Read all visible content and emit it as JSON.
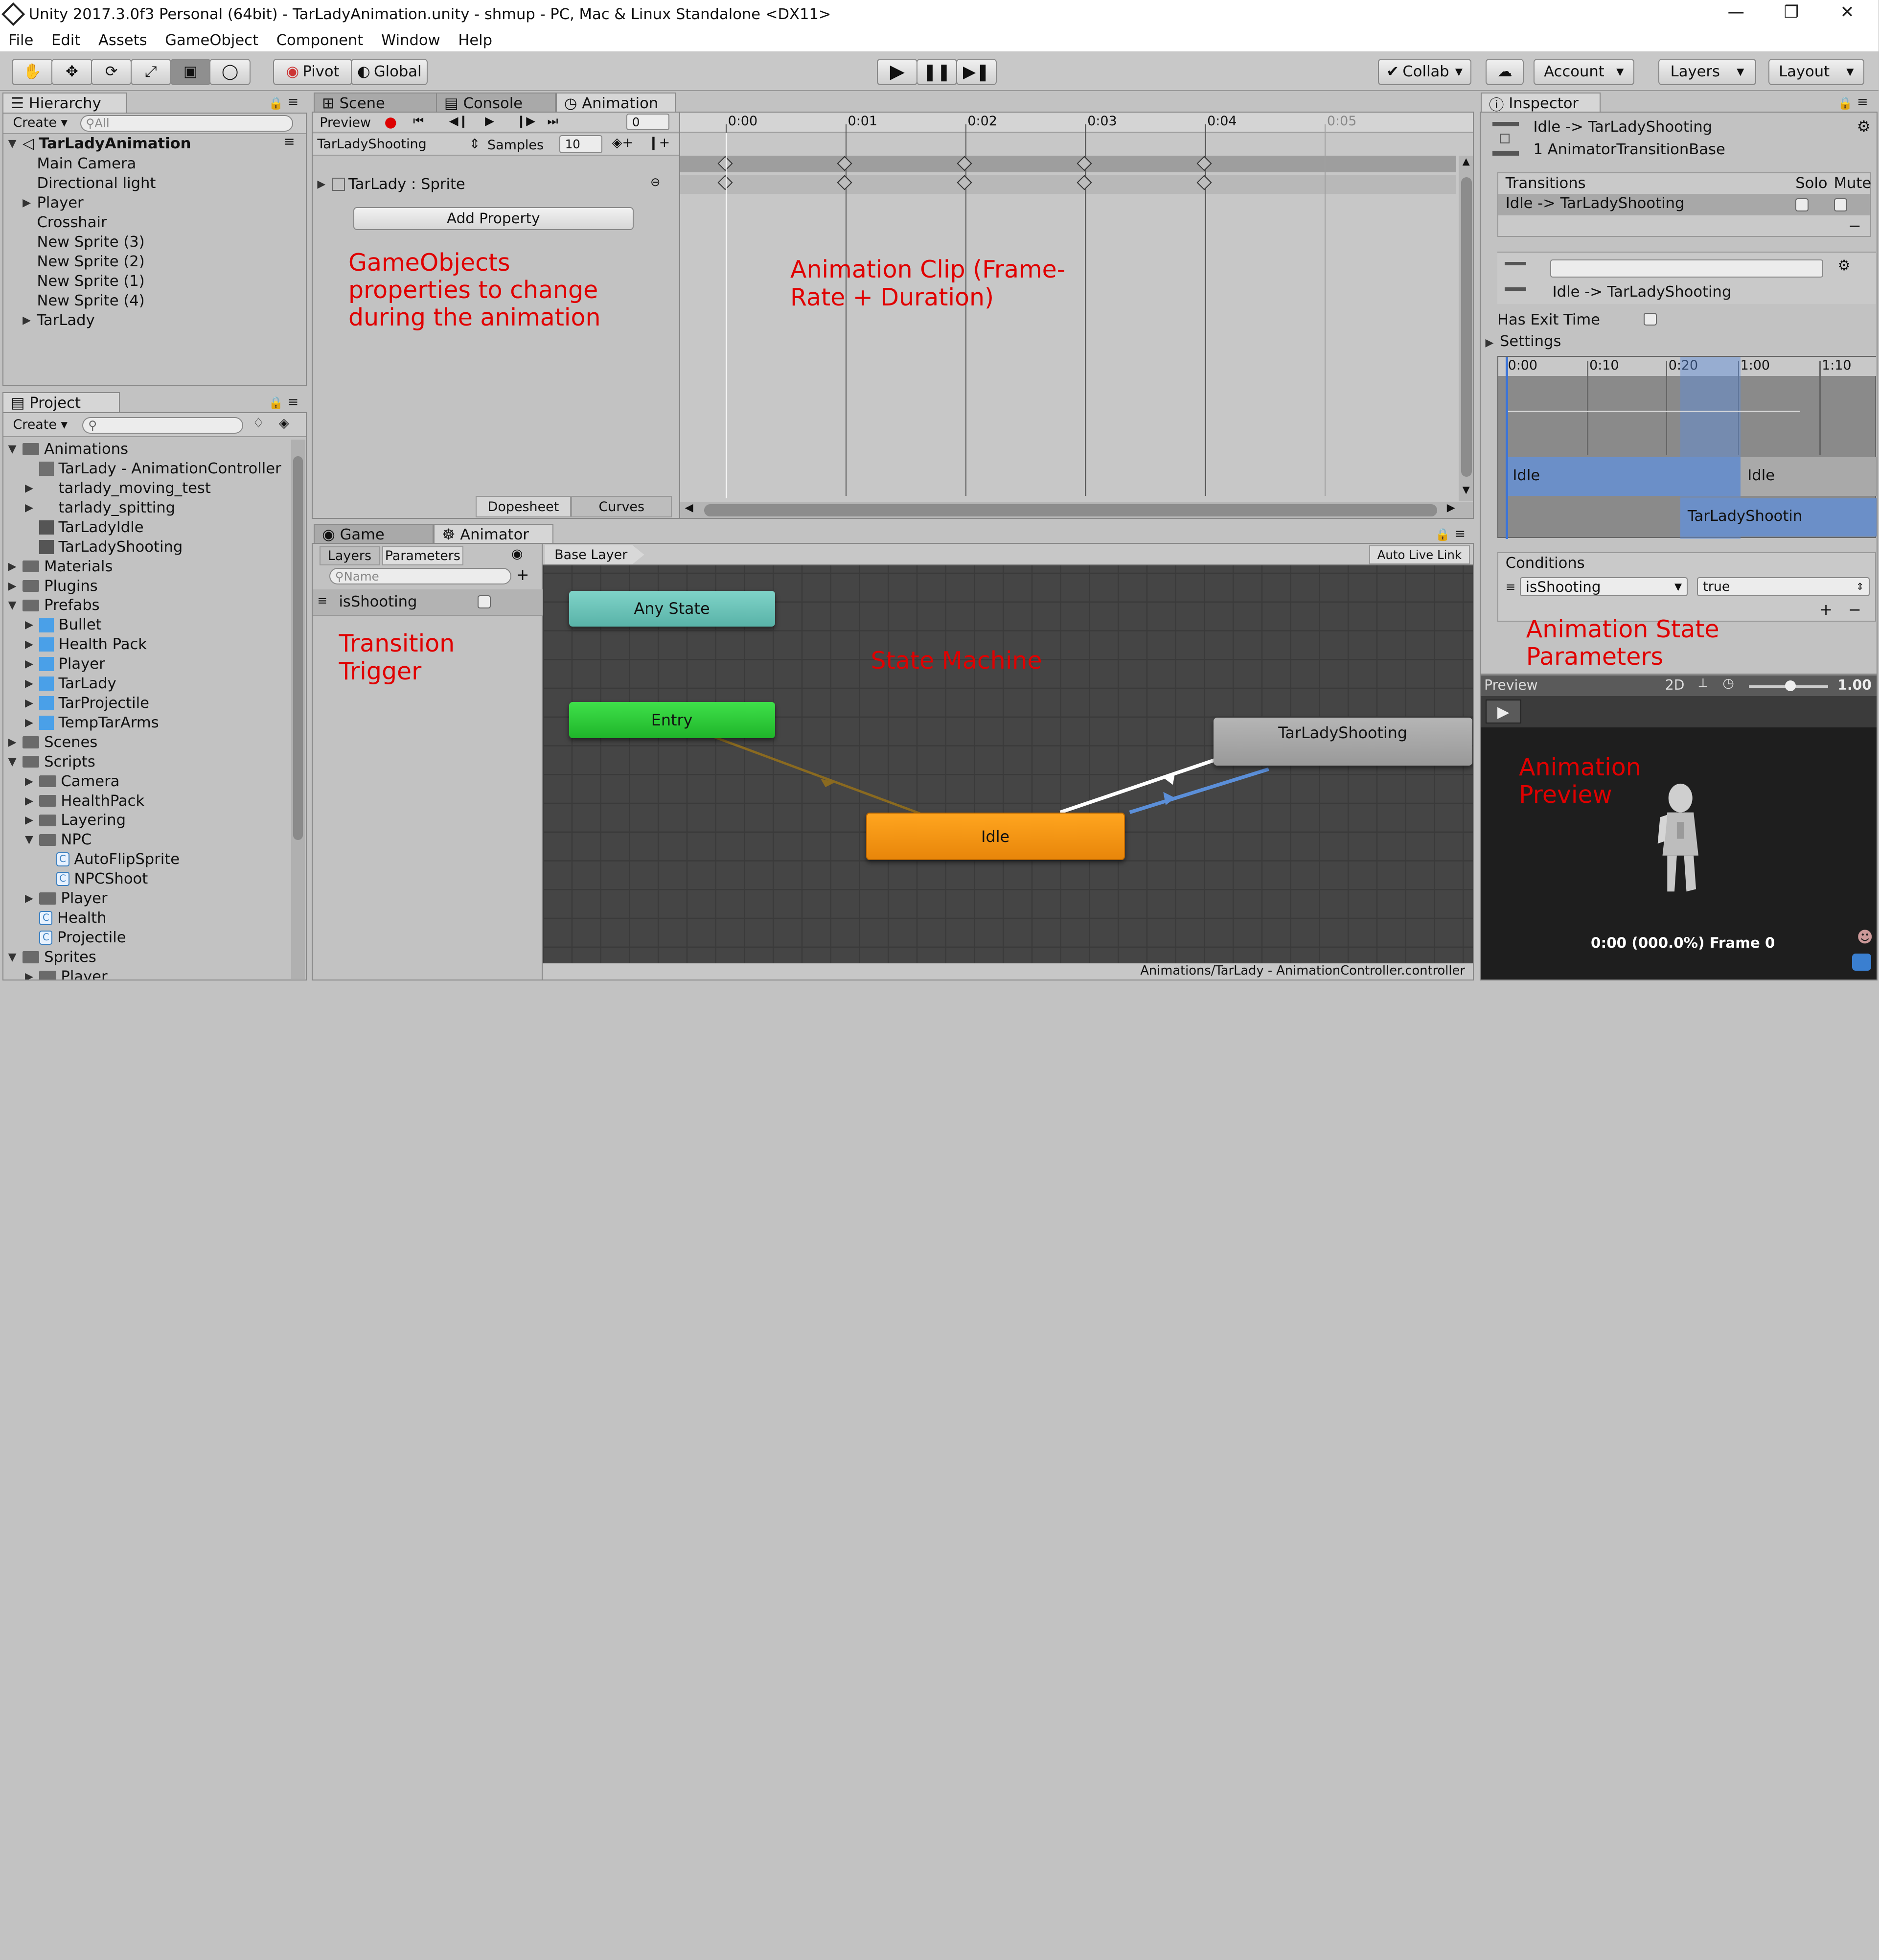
{
  "title": "Unity 2017.3.0f3 Personal (64bit) - TarLadyAnimation.unity - shmup - PC, Mac & Linux Standalone <DX11>",
  "menu": [
    "File",
    "Edit",
    "Assets",
    "GameObject",
    "Component",
    "Window",
    "Help"
  ],
  "toolbar": {
    "pivot": "Pivot",
    "global": "Global",
    "collab": "Collab",
    "account": "Account",
    "layers": "Layers",
    "layout": "Layout"
  },
  "hierarchy": {
    "tab": "Hierarchy",
    "create": "Create",
    "search": "All",
    "scene": "TarLadyAnimation",
    "items": [
      "Main Camera",
      "Directional light",
      "Player",
      "Crosshair",
      "New Sprite (3)",
      "New Sprite (2)",
      "New Sprite (1)",
      "New Sprite (4)",
      "TarLady"
    ]
  },
  "project": {
    "tab": "Project",
    "create": "Create",
    "tree": [
      {
        "label": "Animations",
        "indent": 0,
        "icon": "folder",
        "open": true
      },
      {
        "label": "TarLady - AnimationController",
        "indent": 1,
        "icon": "controller",
        "open": null
      },
      {
        "label": "tarlady_moving_test",
        "indent": 1,
        "icon": "asset",
        "open": false
      },
      {
        "label": "tarlady_spitting",
        "indent": 1,
        "icon": "asset",
        "open": false
      },
      {
        "label": "TarLadyIdle",
        "indent": 1,
        "icon": "clip",
        "open": null
      },
      {
        "label": "TarLadyShooting",
        "indent": 1,
        "icon": "clip",
        "open": null
      },
      {
        "label": "Materials",
        "indent": 0,
        "icon": "folder",
        "open": false
      },
      {
        "label": "Plugins",
        "indent": 0,
        "icon": "folder",
        "open": false
      },
      {
        "label": "Prefabs",
        "indent": 0,
        "icon": "folder",
        "open": true
      },
      {
        "label": "Bullet",
        "indent": 1,
        "icon": "prefab",
        "open": false
      },
      {
        "label": "Health Pack",
        "indent": 1,
        "icon": "prefab",
        "open": false
      },
      {
        "label": "Player",
        "indent": 1,
        "icon": "prefab",
        "open": false
      },
      {
        "label": "TarLady",
        "indent": 1,
        "icon": "prefab",
        "open": false
      },
      {
        "label": "TarProjectile",
        "indent": 1,
        "icon": "prefab",
        "open": false
      },
      {
        "label": "TempTarArms",
        "indent": 1,
        "icon": "prefab",
        "open": false
      },
      {
        "label": "Scenes",
        "indent": 0,
        "icon": "folder",
        "open": false
      },
      {
        "label": "Scripts",
        "indent": 0,
        "icon": "folder",
        "open": true
      },
      {
        "label": "Camera",
        "indent": 1,
        "icon": "folder",
        "open": false
      },
      {
        "label": "HealthPack",
        "indent": 1,
        "icon": "folder",
        "open": false
      },
      {
        "label": "Layering",
        "indent": 1,
        "icon": "folder",
        "open": false
      },
      {
        "label": "NPC",
        "indent": 1,
        "icon": "folder",
        "open": true
      },
      {
        "label": "AutoFlipSprite",
        "indent": 2,
        "icon": "script",
        "open": null
      },
      {
        "label": "NPCShoot",
        "indent": 2,
        "icon": "script",
        "open": null
      },
      {
        "label": "Player",
        "indent": 1,
        "icon": "folder",
        "open": false
      },
      {
        "label": "Health",
        "indent": 1,
        "icon": "script",
        "open": null
      },
      {
        "label": "Projectile",
        "indent": 1,
        "icon": "script",
        "open": null
      },
      {
        "label": "Sprites",
        "indent": 0,
        "icon": "folder",
        "open": true
      },
      {
        "label": "Player",
        "indent": 1,
        "icon": "folder",
        "open": false
      }
    ]
  },
  "animation": {
    "tabs": [
      "Scene",
      "Console",
      "Animation"
    ],
    "preview": "Preview",
    "frame": "0",
    "clip": "TarLadyShooting",
    "samples_label": "Samples",
    "samples": "10",
    "property": "TarLady : Sprite",
    "add_property": "Add Property",
    "dopesheet": "Dopesheet",
    "curves": "Curves",
    "times": [
      "0:00",
      "0:01",
      "0:02",
      "0:03",
      "0:04",
      "0:05"
    ],
    "note1": "GameObjects\nproperties to change\nduring the animation",
    "note2": "Animation Clip (Frame-\nRate + Duration)"
  },
  "animator": {
    "tabs": [
      "Game",
      "Animator"
    ],
    "layers": "Layers",
    "parameters": "Parameters",
    "name_placeholder": "Name",
    "param": "isShooting",
    "base_layer": "Base Layer",
    "auto_live": "Auto Live Link",
    "states": {
      "any": "Any State",
      "entry": "Entry",
      "idle": "Idle",
      "shooting": "TarLadyShooting"
    },
    "note_trigger": "Transition\nTrigger",
    "note_sm": "State Machine",
    "path": "Animations/TarLady - AnimationController.controller"
  },
  "inspector": {
    "tab": "Inspector",
    "name": "Idle -> TarLadyShooting",
    "type": "1 AnimatorTransitionBase",
    "transitions": "Transitions",
    "solo": "Solo",
    "mute": "Mute",
    "row": "Idle -> TarLadyShooting",
    "sub": "Idle -> TarLadyShooting",
    "exit_time": "Has Exit Time",
    "settings": "Settings",
    "timeline": [
      "0:00",
      "0:10",
      "0:20",
      "1:00",
      "1:10"
    ],
    "tl_idle1": "Idle",
    "tl_idle2": "Idle",
    "tl_shoot": "TarLadyShootin",
    "conditions": "Conditions",
    "cond_param": "isShooting",
    "cond_value": "true",
    "note": "Animation State\nParameters"
  },
  "preview": {
    "label": "Preview",
    "mode": "2D",
    "speed": "1.00",
    "status": "0:00 (000.0%) Frame 0",
    "note": "Animation\nPreview"
  }
}
